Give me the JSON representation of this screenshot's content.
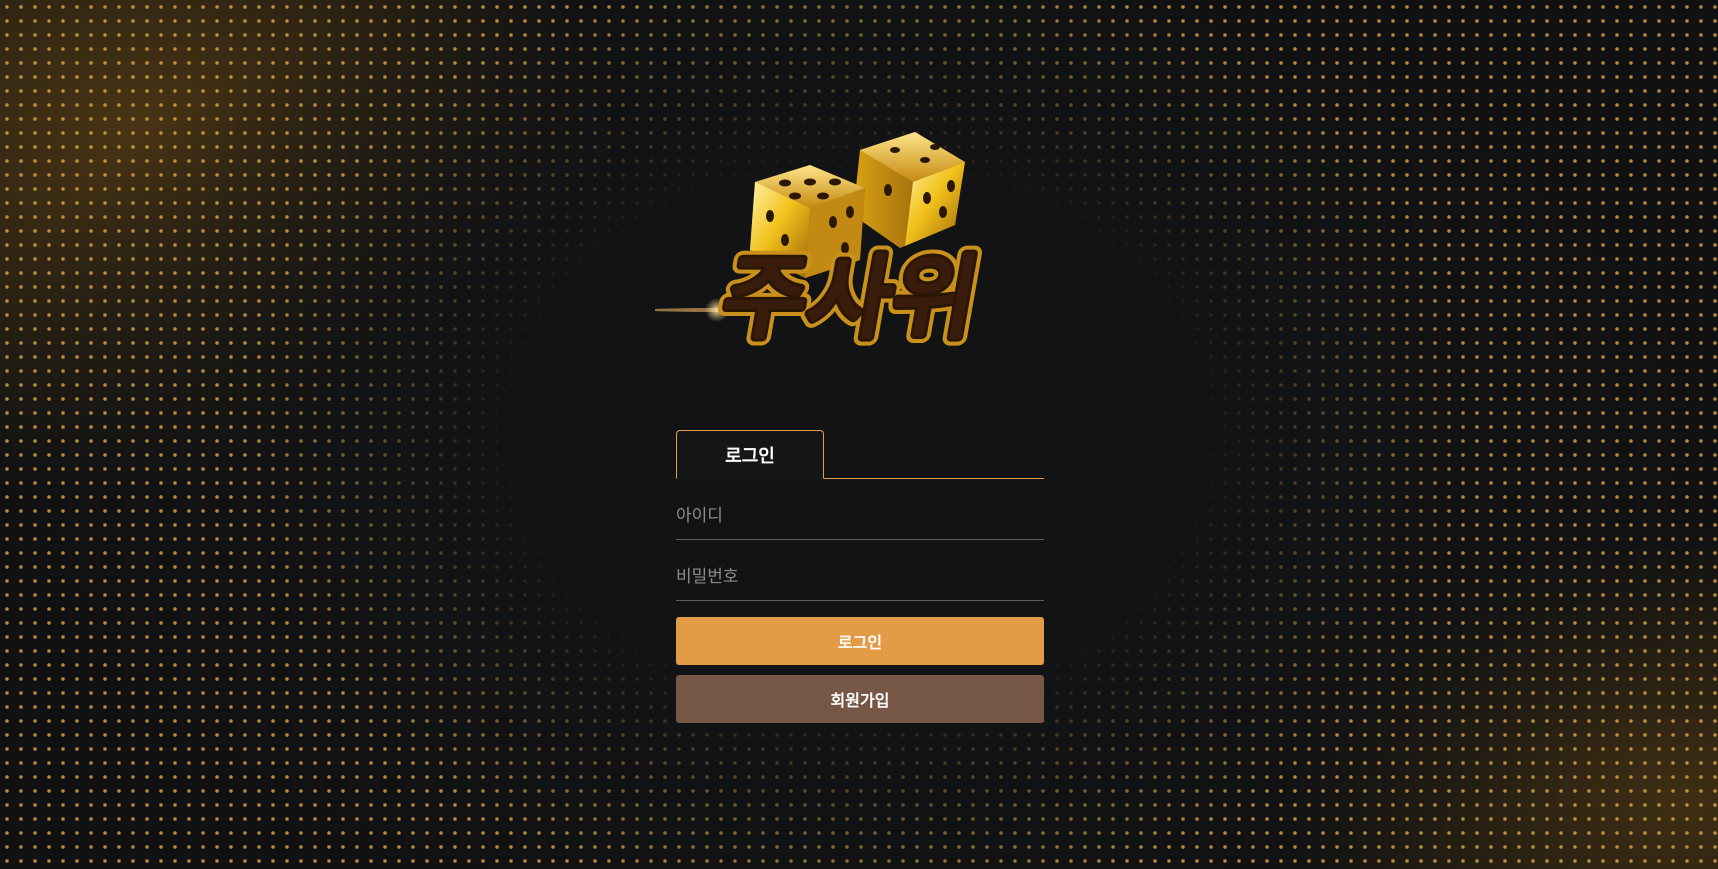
{
  "brand": {
    "logo_text": "주사위",
    "icon": "dice-icon"
  },
  "login": {
    "tab_label": "로그인",
    "username_placeholder": "아이디",
    "username_value": "",
    "password_placeholder": "비밀번호",
    "password_value": "",
    "login_button": "로그인",
    "signup_button": "회원가입"
  },
  "colors": {
    "accent": "#e39b45",
    "signup": "#765644",
    "background": "#101113",
    "dots": "#e8af46"
  }
}
